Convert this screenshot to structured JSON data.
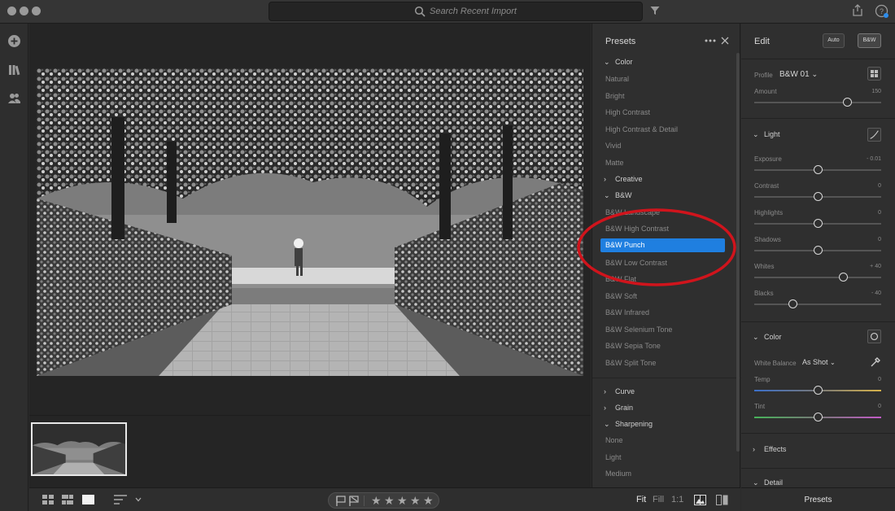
{
  "search": {
    "placeholder": "Search Recent Import"
  },
  "presets": {
    "title": "Presets",
    "groups": [
      {
        "label": "Color",
        "items": [
          "Natural",
          "Bright",
          "High Contrast",
          "High Contrast & Detail",
          "Vivid",
          "Matte"
        ]
      },
      {
        "label": "Creative"
      },
      {
        "label": "B&W",
        "items": [
          "B&W Landscape",
          "B&W High Contrast",
          "B&W Punch",
          "B&W Low Contrast",
          "B&W Flat",
          "B&W Soft",
          "B&W Infrared",
          "B&W Selenium Tone",
          "B&W Sepia Tone",
          "B&W Split Tone"
        ]
      },
      {
        "label": "Curve"
      },
      {
        "label": "Grain"
      },
      {
        "label": "Sharpening",
        "items": [
          "None",
          "Light",
          "Medium"
        ]
      }
    ],
    "selected": "B&W Punch"
  },
  "edit": {
    "title": "Edit",
    "auto_label": "Auto",
    "bw_label": "B&W",
    "profile_label": "Profile",
    "profile_value": "B&W 01",
    "amount_label": "Amount",
    "amount_value": "150",
    "light": {
      "title": "Light",
      "sliders": [
        {
          "label": "Exposure",
          "value": "- 0.01",
          "level": 0.5
        },
        {
          "label": "Contrast",
          "value": "0",
          "level": 0.5
        },
        {
          "label": "Highlights",
          "value": "0",
          "level": 0.5
        },
        {
          "label": "Shadows",
          "value": "0",
          "level": 0.5
        },
        {
          "label": "Whites",
          "value": "+ 40",
          "level": 0.7
        },
        {
          "label": "Blacks",
          "value": "- 40",
          "level": 0.3
        }
      ]
    },
    "color": {
      "title": "Color",
      "wb_label": "White Balance",
      "wb_value": "As Shot",
      "temp_label": "Temp",
      "temp_value": "0",
      "tint_label": "Tint",
      "tint_value": "0"
    },
    "effects_title": "Effects",
    "detail_title": "Detail"
  },
  "bottom": {
    "fit": "Fit",
    "fill": "Fill",
    "one_to_one": "1:1",
    "presets_tab": "Presets"
  },
  "colors": {
    "accent": "#1f7fe0",
    "annotation": "#d0141c"
  }
}
